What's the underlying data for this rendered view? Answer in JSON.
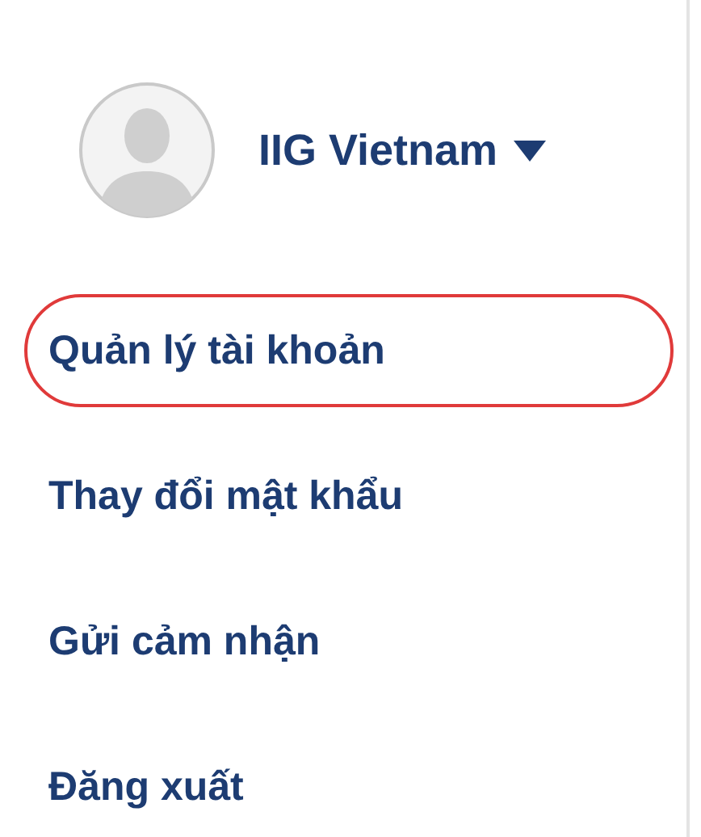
{
  "profile": {
    "name": "IIG Vietnam"
  },
  "menu": [
    {
      "label": "Quản lý tài khoản",
      "selected": true
    },
    {
      "label": "Thay đổi mật khẩu",
      "selected": false
    },
    {
      "label": "Gửi cảm nhận",
      "selected": false
    },
    {
      "label": "Đăng xuất",
      "selected": false
    }
  ]
}
